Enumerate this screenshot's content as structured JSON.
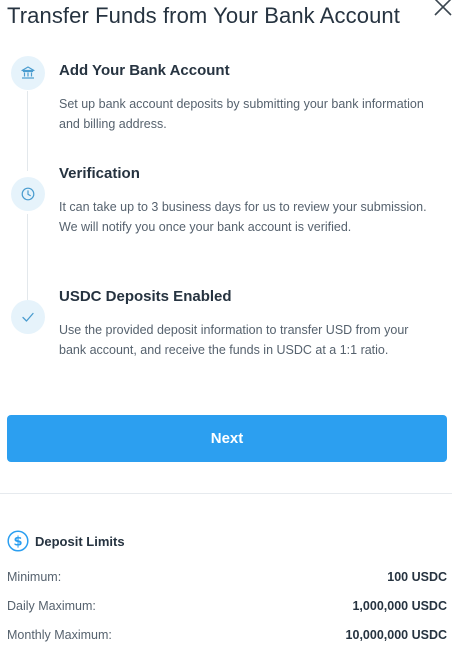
{
  "title": "Transfer Funds from Your Bank Account",
  "steps": [
    {
      "icon": "bank-icon",
      "title": "Add Your Bank Account",
      "description": "Set up bank account deposits by submitting your bank information and billing address."
    },
    {
      "icon": "clock-icon",
      "title": "Verification",
      "description": "It can take up to 3 business days for us to review your submission. We will notify you once your bank account is verified."
    },
    {
      "icon": "check-icon",
      "title": "USDC Deposits Enabled",
      "description": "Use the provided deposit information to transfer USD from your bank account, and receive the funds in USDC at a 1:1 ratio."
    }
  ],
  "next_label": "Next",
  "limits": {
    "title": "Deposit Limits",
    "icon": "dollar-icon",
    "rows": [
      {
        "label": "Minimum:",
        "value": "100 USDC"
      },
      {
        "label": "Daily Maximum:",
        "value": "1,000,000 USDC"
      },
      {
        "label": "Monthly Maximum:",
        "value": "10,000,000 USDC"
      }
    ]
  },
  "colors": {
    "accent": "#2c9ff0",
    "icon_bg": "#e6f3fb",
    "icon_stroke": "#4a9ccf"
  }
}
